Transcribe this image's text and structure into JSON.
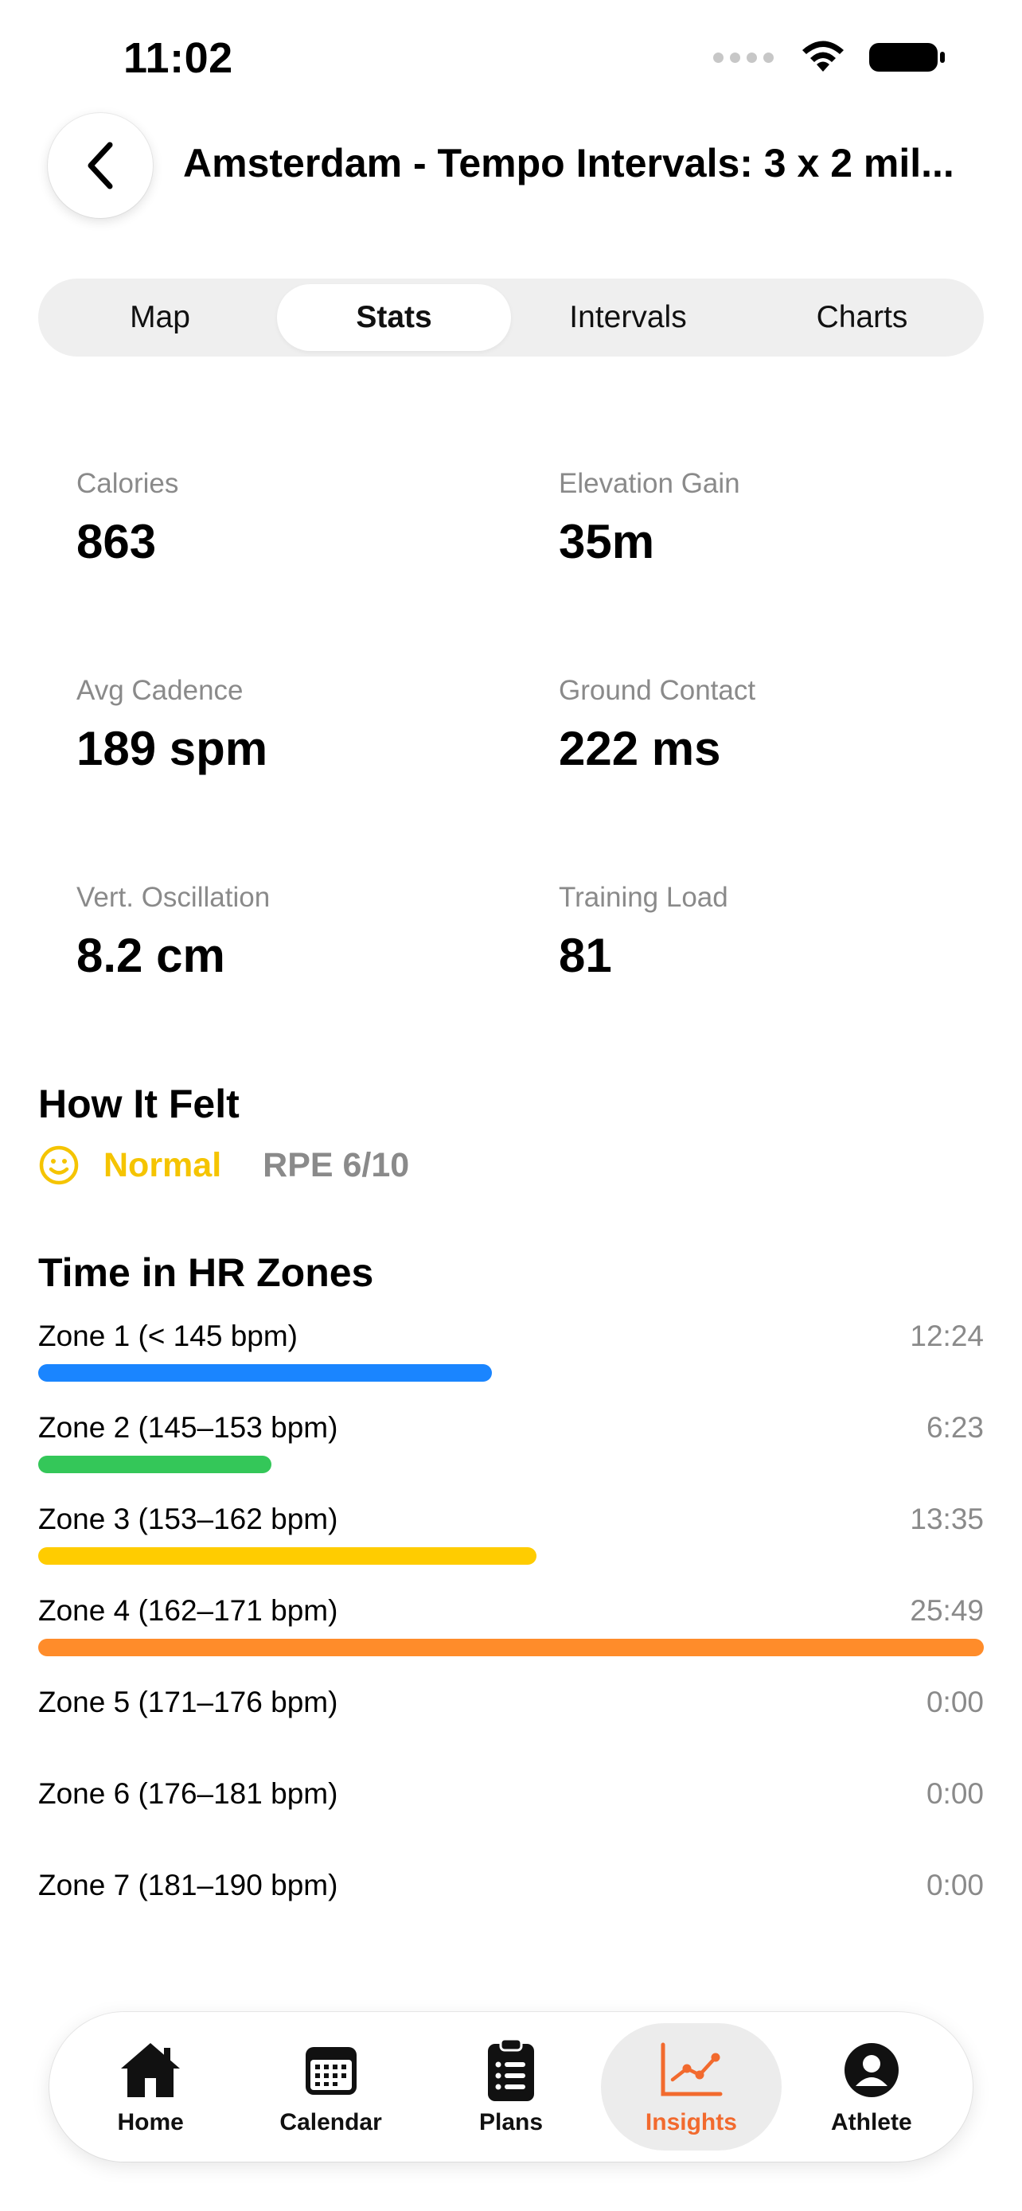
{
  "status": {
    "time": "11:02"
  },
  "header": {
    "title": "Amsterdam - Tempo Intervals: 3 x 2 mil..."
  },
  "tabs": [
    {
      "label": "Map",
      "active": false
    },
    {
      "label": "Stats",
      "active": true
    },
    {
      "label": "Intervals",
      "active": false
    },
    {
      "label": "Charts",
      "active": false
    }
  ],
  "stats": [
    {
      "label": "Calories",
      "value": "863"
    },
    {
      "label": "Elevation Gain",
      "value": "35m"
    },
    {
      "label": "Avg Cadence",
      "value": "189 spm"
    },
    {
      "label": "Ground Contact",
      "value": "222 ms"
    },
    {
      "label": "Vert. Oscillation",
      "value": "8.2 cm"
    },
    {
      "label": "Training Load",
      "value": "81"
    }
  ],
  "felt": {
    "title": "How It Felt",
    "feeling": "Normal",
    "rpe": "RPE 6/10",
    "icon": "smiley-icon",
    "color": "#f5c400"
  },
  "hr_zones": {
    "title": "Time in HR Zones",
    "zones": [
      {
        "name": "Zone 1 (< 145 bpm)",
        "time": "12:24",
        "fraction": 0.48,
        "color": "#1a85ff"
      },
      {
        "name": "Zone 2 (145–153 bpm)",
        "time": "6:23",
        "fraction": 0.247,
        "color": "#34c759"
      },
      {
        "name": "Zone 3 (153–162 bpm)",
        "time": "13:35",
        "fraction": 0.527,
        "color": "#ffcc00"
      },
      {
        "name": "Zone 4 (162–171 bpm)",
        "time": "25:49",
        "fraction": 1.0,
        "color": "#ff8c2a"
      },
      {
        "name": "Zone 5 (171–176 bpm)",
        "time": "0:00",
        "fraction": 0,
        "color": "#ff3b30"
      },
      {
        "name": "Zone 6 (176–181 bpm)",
        "time": "0:00",
        "fraction": 0,
        "color": "#af52de"
      },
      {
        "name": "Zone 7 (181–190 bpm)",
        "time": "0:00",
        "fraction": 0,
        "color": "#5856d6"
      }
    ]
  },
  "tabbar": {
    "items": [
      {
        "label": "Home",
        "icon": "house-icon",
        "active": false
      },
      {
        "label": "Calendar",
        "icon": "calendar-icon",
        "active": false
      },
      {
        "label": "Plans",
        "icon": "clipboard-icon",
        "active": false
      },
      {
        "label": "Insights",
        "icon": "chart-line-icon",
        "active": true
      },
      {
        "label": "Athlete",
        "icon": "person-circle-icon",
        "active": false
      }
    ],
    "accent": "#f26a2e"
  }
}
